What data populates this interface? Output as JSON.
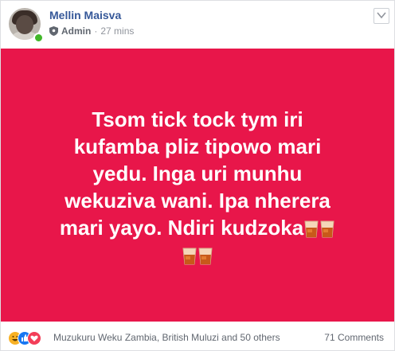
{
  "author": {
    "name": "Mellin Maisva",
    "role": "Admin",
    "separator": "·",
    "time": "27 mins",
    "online": true
  },
  "post": {
    "background": "#e8164a",
    "text_lines": [
      "Tsom tick tock tym iri",
      "kufamba pliz tipowo mari",
      "yedu. Inga uri munhu",
      "wekuziva wani. Ipa nherera",
      "mari yayo. Ndiri kudzoka"
    ],
    "emoji": "tumbler-glass"
  },
  "reactions": {
    "icons": [
      "haha-icon",
      "like-icon",
      "love-icon"
    ],
    "summary": "Muzukuru Weku Zambia, British Muluzi and 50 others",
    "comments": "71 Comments"
  },
  "colors": {
    "name": "#365899",
    "meta": "#90949c",
    "online": "#42b72a"
  }
}
